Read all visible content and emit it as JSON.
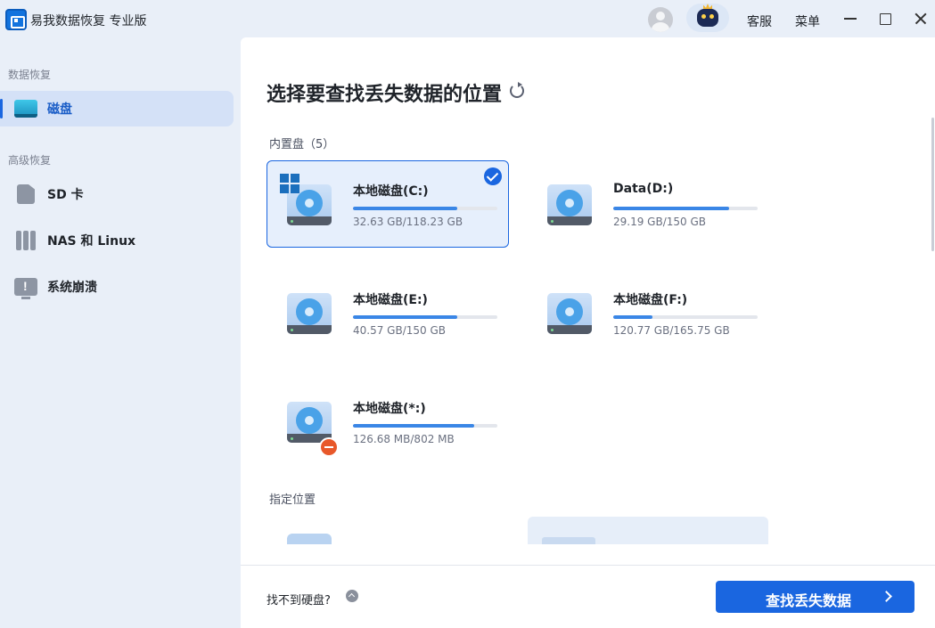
{
  "app": {
    "title": "易我数据恢复 专业版"
  },
  "titlebar": {
    "support_label": "客服",
    "menu_label": "菜单"
  },
  "sidebar": {
    "sections": [
      {
        "label": "数据恢复"
      },
      {
        "label": "高级恢复"
      }
    ],
    "items": [
      {
        "label": "磁盘",
        "icon": "disk-icon",
        "active": true
      },
      {
        "label": "SD 卡",
        "icon": "sd-card-icon"
      },
      {
        "label": "NAS 和 Linux",
        "icon": "nas-icon"
      },
      {
        "label": "系统崩溃",
        "icon": "system-crash-icon"
      }
    ]
  },
  "main": {
    "title": "选择要查找丢失数据的位置",
    "internal_label": "内置盘（5）",
    "specified_label": "指定位置",
    "disks": [
      {
        "name": "本地磁盘(C:)",
        "size": "32.63 GB/118.23 GB",
        "used_fraction": 0.72,
        "selected": true,
        "system": true
      },
      {
        "name": "Data(D:)",
        "size": "29.19 GB/150 GB",
        "used_fraction": 0.8
      },
      {
        "name": "本地磁盘(E:)",
        "size": "40.57 GB/150 GB",
        "used_fraction": 0.72
      },
      {
        "name": "本地磁盘(F:)",
        "size": "120.77 GB/165.75 GB",
        "used_fraction": 0.27
      },
      {
        "name": "本地磁盘(*:)",
        "size": "126.68 MB/802 MB",
        "used_fraction": 0.84,
        "warning": true
      }
    ]
  },
  "bottom": {
    "no_disk_text": "找不到硬盘?",
    "scan_button": "查找丢失数据"
  },
  "colors": {
    "accent": "#1a66e0",
    "bar": "#3a86e6",
    "warning": "#e8582a"
  }
}
